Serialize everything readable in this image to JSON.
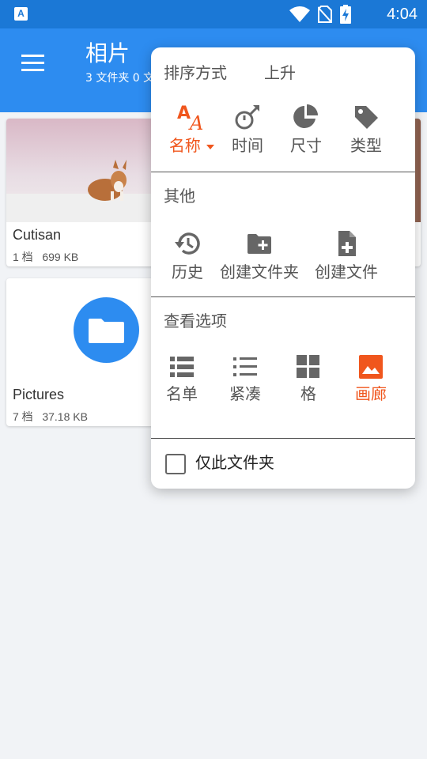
{
  "status_bar": {
    "time": "4:04",
    "app_icon_letter": "A",
    "icons": [
      "wifi-icon",
      "no-sim-icon",
      "battery-charging-icon"
    ]
  },
  "app_bar": {
    "title": "相片",
    "subtitle": "3 文件夹 0 文"
  },
  "folders": [
    {
      "name": "Cutisan",
      "meta": "1 档   699 KB"
    },
    {
      "name": "Pictures",
      "meta": "7 档   37.18 KB"
    }
  ],
  "popup": {
    "sort": {
      "title": "排序方式",
      "direction": "上升",
      "options": [
        {
          "label": "名称",
          "icon": "sort-name-icon",
          "active": true
        },
        {
          "label": "时间",
          "icon": "timer-icon",
          "active": false
        },
        {
          "label": "尺寸",
          "icon": "pie-chart-icon",
          "active": false
        },
        {
          "label": "类型",
          "icon": "tag-icon",
          "active": false
        }
      ]
    },
    "other": {
      "title": "其他",
      "options": [
        {
          "label": "历史",
          "icon": "history-icon"
        },
        {
          "label": "创建文件夹",
          "icon": "create-folder-icon"
        },
        {
          "label": "创建文件",
          "icon": "create-file-icon"
        }
      ]
    },
    "view": {
      "title": "查看选项",
      "options": [
        {
          "label": "名单",
          "icon": "list-icon",
          "active": false
        },
        {
          "label": "紧凑",
          "icon": "compact-list-icon",
          "active": false
        },
        {
          "label": "格",
          "icon": "grid-icon",
          "active": false
        },
        {
          "label": "画廊",
          "icon": "gallery-icon",
          "active": true
        }
      ]
    },
    "only_this_folder": {
      "label": "仅此文件夹",
      "checked": false
    }
  },
  "colors": {
    "primary": "#2d8cf0",
    "status_bar": "#1b78d6",
    "accent": "#f0561d",
    "icon_gray": "#666666"
  }
}
